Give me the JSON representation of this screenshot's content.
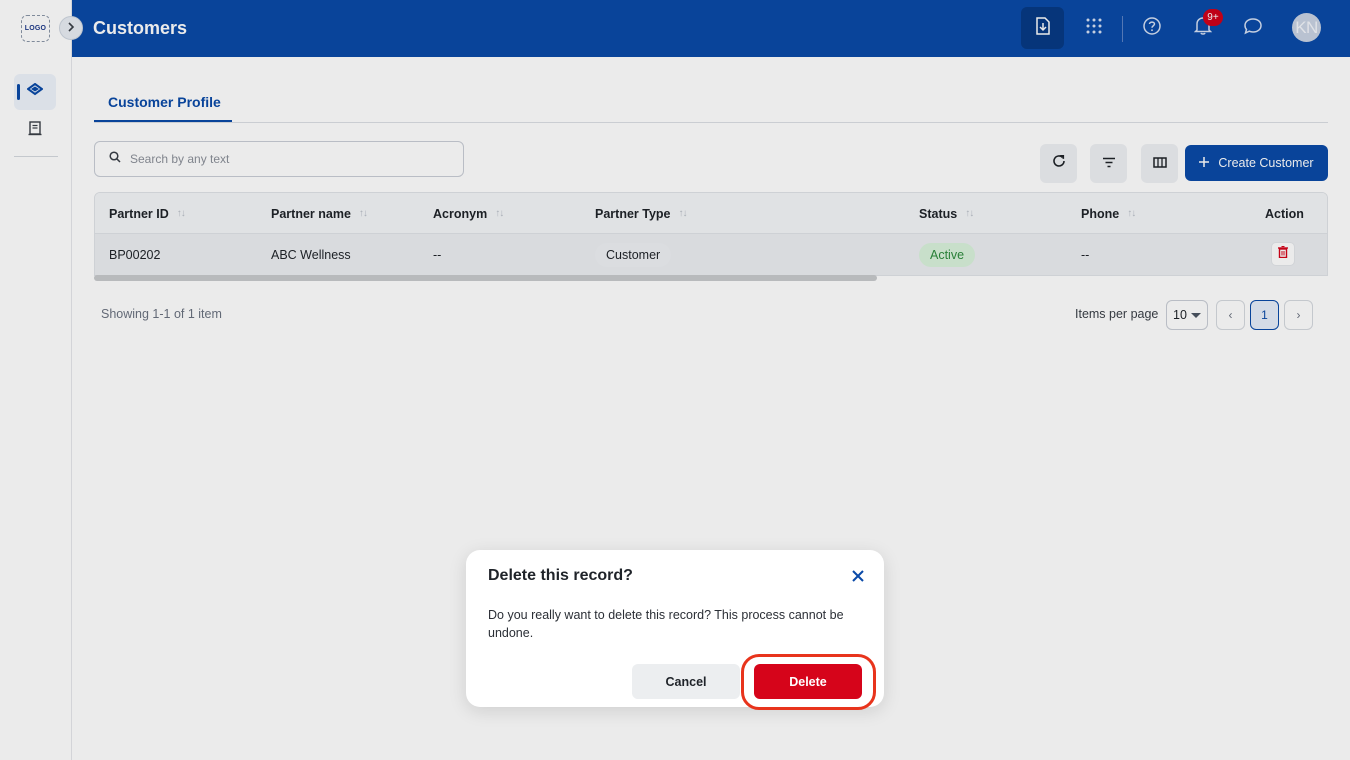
{
  "sidebar": {
    "logo_text": "LOGO",
    "items": [
      {
        "icon": "diamond-layers-icon",
        "active": true
      },
      {
        "icon": "document-list-icon",
        "active": false
      }
    ]
  },
  "header": {
    "title": "Customers",
    "notification_badge": "9+",
    "avatar_initials": "KN",
    "icons": [
      "download-document-icon",
      "apps-grid-icon",
      "help-icon",
      "bell-icon",
      "chat-icon"
    ]
  },
  "tabs": [
    {
      "label": "Customer Profile",
      "active": true
    }
  ],
  "search": {
    "placeholder": "Search by any text"
  },
  "toolbar": {
    "create_label": "Create Customer"
  },
  "table": {
    "columns": [
      "Partner ID",
      "Partner name",
      "Acronym",
      "Partner Type",
      "Status",
      "Phone",
      "Action"
    ],
    "rows": [
      {
        "partner_id": "BP00202",
        "partner_name": "ABC Wellness",
        "acronym": "--",
        "partner_type": "Customer",
        "status": "Active",
        "phone": "--"
      }
    ]
  },
  "pagination": {
    "showing": "Showing 1-1 of 1 item",
    "items_per_page_label": "Items per page",
    "items_per_page": "10",
    "current_page": "1",
    "prev": "‹",
    "next": "›"
  },
  "modal": {
    "title": "Delete this record?",
    "body": "Do you really want to delete this record? This process cannot be undone.",
    "cancel_label": "Cancel",
    "delete_label": "Delete"
  },
  "colors": {
    "brand": "#0a4aa8",
    "danger": "#d6041a",
    "status_active_bg": "#d9f2dc",
    "highlight": "#e8341c"
  }
}
